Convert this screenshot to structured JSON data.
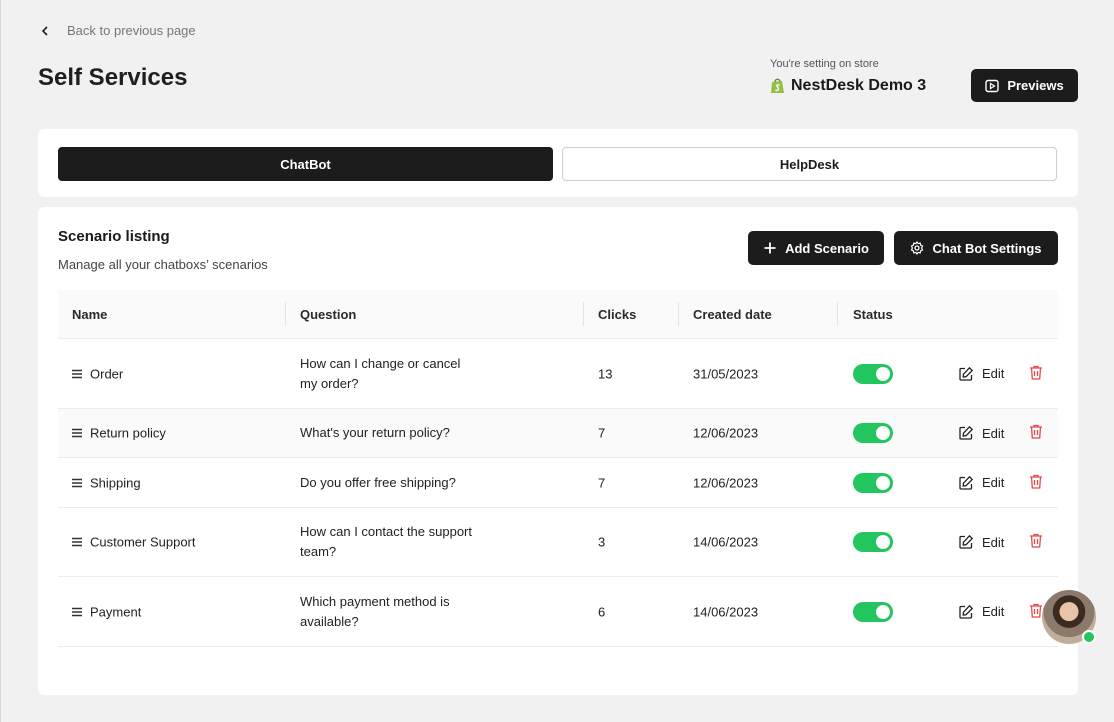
{
  "back_label": "Back to previous page",
  "page_title": "Self Services",
  "store": {
    "caption": "You're setting on store",
    "name": "NestDesk Demo 3"
  },
  "previews_label": "Previews",
  "tabs": [
    {
      "label": "ChatBot",
      "active": true
    },
    {
      "label": "HelpDesk",
      "active": false
    }
  ],
  "listing": {
    "title": "Scenario listing",
    "subtitle": "Manage all your chatboxs’ scenarios",
    "add_label": "Add Scenario",
    "settings_label": "Chat Bot Settings"
  },
  "table": {
    "headers": [
      "Name",
      "Question",
      "Clicks",
      "Created date",
      "Status"
    ],
    "edit_label": "Edit",
    "rows": [
      {
        "name": "Order",
        "question": "How can I change or cancel my order?",
        "clicks": "13",
        "date": "31/05/2023",
        "status": true
      },
      {
        "name": "Return policy",
        "question": "What's your return policy?",
        "clicks": "7",
        "date": "12/06/2023",
        "status": true
      },
      {
        "name": "Shipping",
        "question": "Do you offer free shipping?",
        "clicks": "7",
        "date": "12/06/2023",
        "status": true
      },
      {
        "name": "Customer Support",
        "question": "How can I contact the support team?",
        "clicks": "3",
        "date": "14/06/2023",
        "status": true
      },
      {
        "name": "Payment",
        "question": "Which payment method is available?",
        "clicks": "6",
        "date": "14/06/2023",
        "status": true
      }
    ]
  },
  "colors": {
    "primary": "#1c1c1c",
    "toggle_on": "#22c55e",
    "delete": "#e5484d",
    "online": "#22c55e"
  }
}
